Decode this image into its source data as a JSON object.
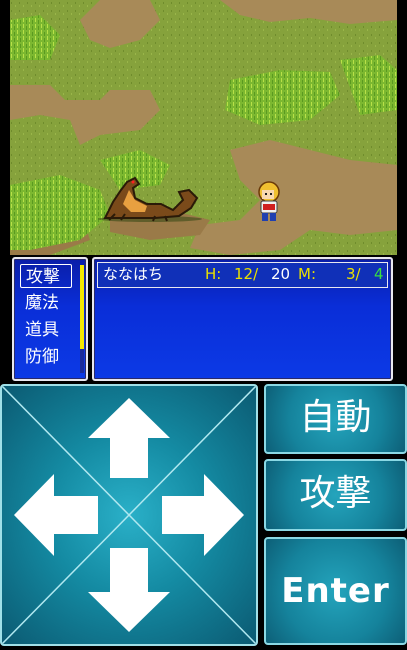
{
  "battle": {
    "commands": [
      {
        "label": "攻撃",
        "selected": true
      },
      {
        "label": "魔法",
        "selected": false
      },
      {
        "label": "道具",
        "selected": false
      },
      {
        "label": "防御",
        "selected": false
      }
    ],
    "party": [
      {
        "name": "ななはち",
        "hp_label": "H:",
        "hp_current": "12/",
        "hp_max": "20",
        "mp_label": "M:",
        "mp_current": "3/",
        "mp_max": "4"
      }
    ]
  },
  "controls": {
    "dpad": [
      "up-arrow-icon",
      "down-arrow-icon",
      "left-arrow-icon",
      "right-arrow-icon"
    ],
    "auto_label": "自動",
    "attack_label": "攻撃",
    "enter_label": "Enter"
  },
  "colors": {
    "grass": "#86a23c",
    "path": "#a88a58",
    "window_blue": "#0a2ed8",
    "control_teal": "#148aa2",
    "hp_label": "#e8e000",
    "mp_value": "#38e040"
  }
}
